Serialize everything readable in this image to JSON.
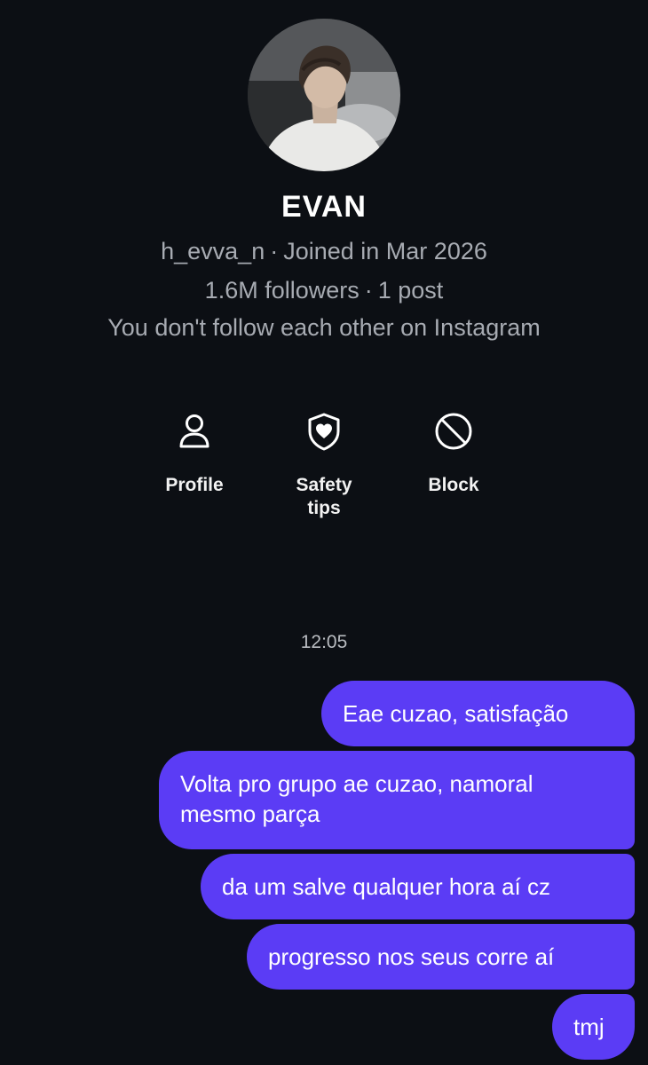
{
  "profile": {
    "name": "EVAN",
    "username": "h_evva_n",
    "separator": "·",
    "joined": "Joined in Mar 2026",
    "followers": "1.6M followers",
    "posts": "1 post",
    "follow_status": "You don't follow each other on Instagram",
    "avatar_icon": "avatar-photo"
  },
  "actions": [
    {
      "label": "Profile",
      "icon": "person-icon"
    },
    {
      "label": "Safety tips",
      "icon": "shield-heart-icon"
    },
    {
      "label": "Block",
      "icon": "block-icon"
    }
  ],
  "conversation": {
    "timestamp": "12:05",
    "messages": [
      {
        "text": "Eae cuzao, satisfação",
        "sender": "me"
      },
      {
        "text": "Volta pro grupo ae cuzao, namoral mesmo parça",
        "sender": "me"
      },
      {
        "text": "da um salve qualquer hora aí cz",
        "sender": "me"
      },
      {
        "text": "progresso nos seus corre aí",
        "sender": "me"
      },
      {
        "text": "tmj",
        "sender": "me"
      }
    ]
  },
  "colors": {
    "background": "#0c0f14",
    "bubble": "#5b3cf5",
    "secondary_text": "#a7abb2"
  }
}
